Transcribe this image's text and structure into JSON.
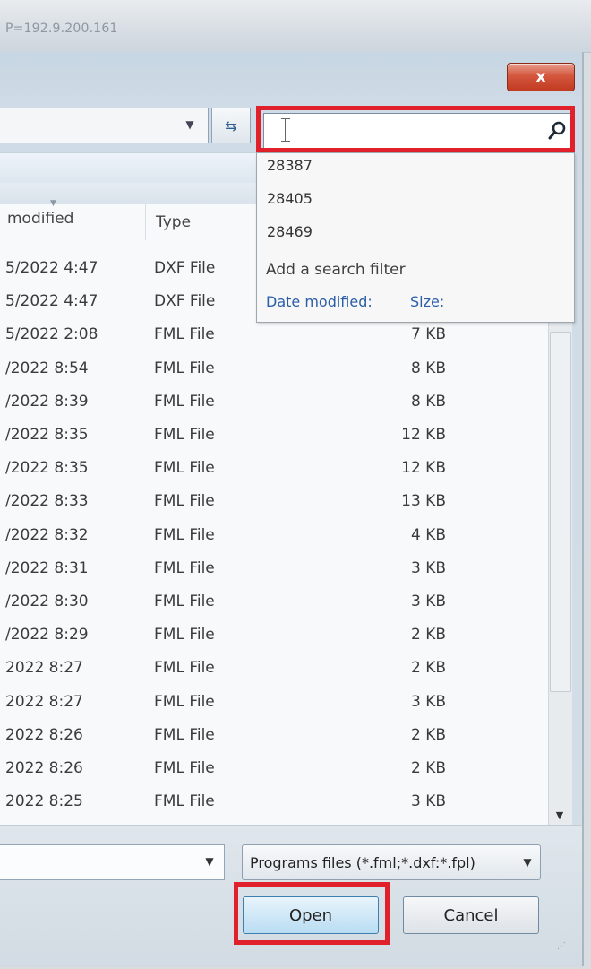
{
  "window": {
    "title_fragment": "P=192.9.200.161",
    "close_label": "x"
  },
  "search": {
    "value": "",
    "placeholder": "",
    "suggestions": [
      "28387",
      "28405",
      "28469"
    ],
    "add_filter_label": "Add a search filter",
    "filters": [
      "Date modified:",
      "Size:"
    ]
  },
  "columns": {
    "date": "modified",
    "type": "Type"
  },
  "files": [
    {
      "date": "5/2022 4:47",
      "type": "DXF File",
      "size": ""
    },
    {
      "date": "5/2022 4:47",
      "type": "DXF File",
      "size": ""
    },
    {
      "date": "5/2022 2:08",
      "type": "FML File",
      "size": "7 KB"
    },
    {
      "date": "/2022 8:54",
      "type": "FML File",
      "size": "8 KB"
    },
    {
      "date": "/2022 8:39",
      "type": "FML File",
      "size": "8 KB"
    },
    {
      "date": "/2022 8:35",
      "type": "FML File",
      "size": "12 KB"
    },
    {
      "date": "/2022 8:35",
      "type": "FML File",
      "size": "12 KB"
    },
    {
      "date": "/2022 8:33",
      "type": "FML File",
      "size": "13 KB"
    },
    {
      "date": "/2022 8:32",
      "type": "FML File",
      "size": "4 KB"
    },
    {
      "date": "/2022 8:31",
      "type": "FML File",
      "size": "3 KB"
    },
    {
      "date": "/2022 8:30",
      "type": "FML File",
      "size": "3 KB"
    },
    {
      "date": "/2022 8:29",
      "type": "FML File",
      "size": "2 KB"
    },
    {
      "date": "2022 8:27",
      "type": "FML File",
      "size": "2 KB"
    },
    {
      "date": "2022 8:27",
      "type": "FML File",
      "size": "3 KB"
    },
    {
      "date": "2022 8:26",
      "type": "FML File",
      "size": "2 KB"
    },
    {
      "date": "2022 8:26",
      "type": "FML File",
      "size": "2 KB"
    },
    {
      "date": "2022 8:25",
      "type": "FML File",
      "size": "3 KB"
    }
  ],
  "footer": {
    "file_type": "Programs files (*.fml;*.dxf:*.fpl)",
    "open_label": "Open",
    "cancel_label": "Cancel"
  },
  "colors": {
    "highlight": "#e0202a",
    "link": "#2a5ea8",
    "close_button": "#c13b22"
  },
  "icons": [
    "search-icon",
    "refresh-icon",
    "close-icon",
    "chevron-down-icon"
  ]
}
